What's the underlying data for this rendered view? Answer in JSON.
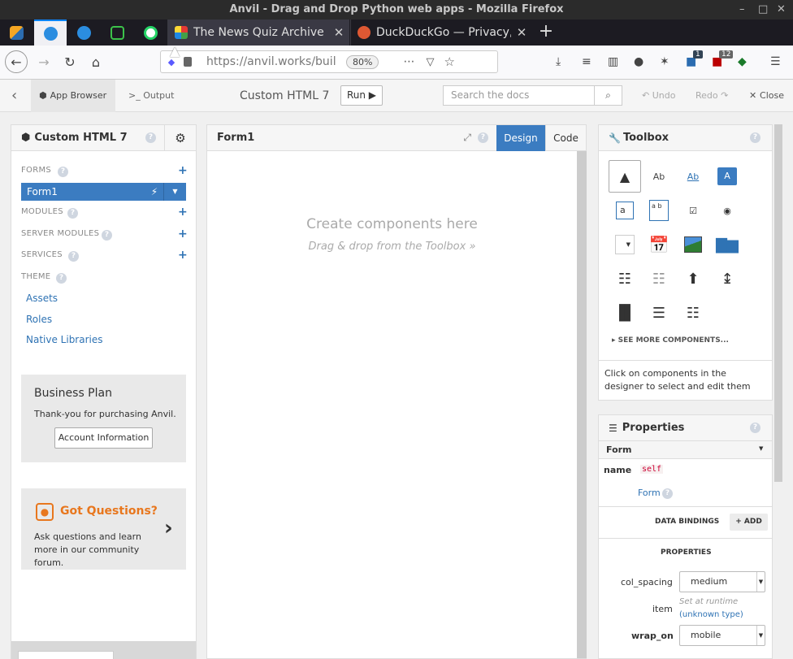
{
  "browser": {
    "window_title": "Anvil - Drag and Drop Python web apps - Mozilla Firefox",
    "tabs": [
      {
        "label": "The News Quiz Archive",
        "close": "✕"
      },
      {
        "label": "DuckDuckGo — Privacy, simplified.",
        "close": "✕"
      }
    ],
    "new_tab": "+",
    "url": "https://anvil.works/build",
    "zoom": "80%",
    "badges": {
      "first": "1",
      "second": "12"
    }
  },
  "app_header": {
    "back": "‹",
    "app_browser": "App Browser",
    "output": ">_ Output",
    "app_title": "Custom HTML 7",
    "run": "Run ▶",
    "search_placeholder": "Search the docs",
    "undo": "Undo",
    "redo": "Redo",
    "close": "Close"
  },
  "left_panel": {
    "title": "Custom HTML 7",
    "sections": {
      "forms": "FORMS",
      "modules": "MODULES",
      "server_modules": "SERVER MODULES",
      "services": "SERVICES",
      "theme": "THEME"
    },
    "form_item": "Form1",
    "theme_links": [
      "Assets",
      "Roles",
      "Native Libraries"
    ],
    "business": {
      "title": "Business Plan",
      "text": "Thank-you for purchasing Anvil.",
      "button": "Account Information"
    },
    "questions": {
      "title": "Got Questions?",
      "text": "Ask questions and learn more in our community forum."
    }
  },
  "designer": {
    "title": "Form1",
    "design_tab": "Design",
    "code_tab": "Code",
    "placeholder_main": "Create components here",
    "placeholder_sub": "Drag & drop from the Toolbox »"
  },
  "toolbox": {
    "title": "Toolbox",
    "see_more": "SEE MORE COMPONENTS...",
    "hint": "Click on components in the designer to select and edit them",
    "tool_text": {
      "label": "Ab",
      "link": "Ab",
      "button": "A",
      "textbox": "a",
      "textarea": "a b"
    }
  },
  "properties": {
    "title": "Properties",
    "type": "Form",
    "name_label": "name",
    "name_value": "self",
    "form_link": "Form",
    "data_bindings": "DATA BINDINGS",
    "add": "+ ADD",
    "props_header": "PROPERTIES",
    "col_spacing_label": "col_spacing",
    "col_spacing_value": "medium",
    "item_label": "item",
    "item_value": "Set at runtime",
    "item_type": "(unknown type)",
    "wrap_on_label": "wrap_on",
    "wrap_on_value": "mobile"
  },
  "colors": {
    "accent": "#2f73b4",
    "form_selected": "#3b7cc1",
    "orange": "#e8771e"
  }
}
